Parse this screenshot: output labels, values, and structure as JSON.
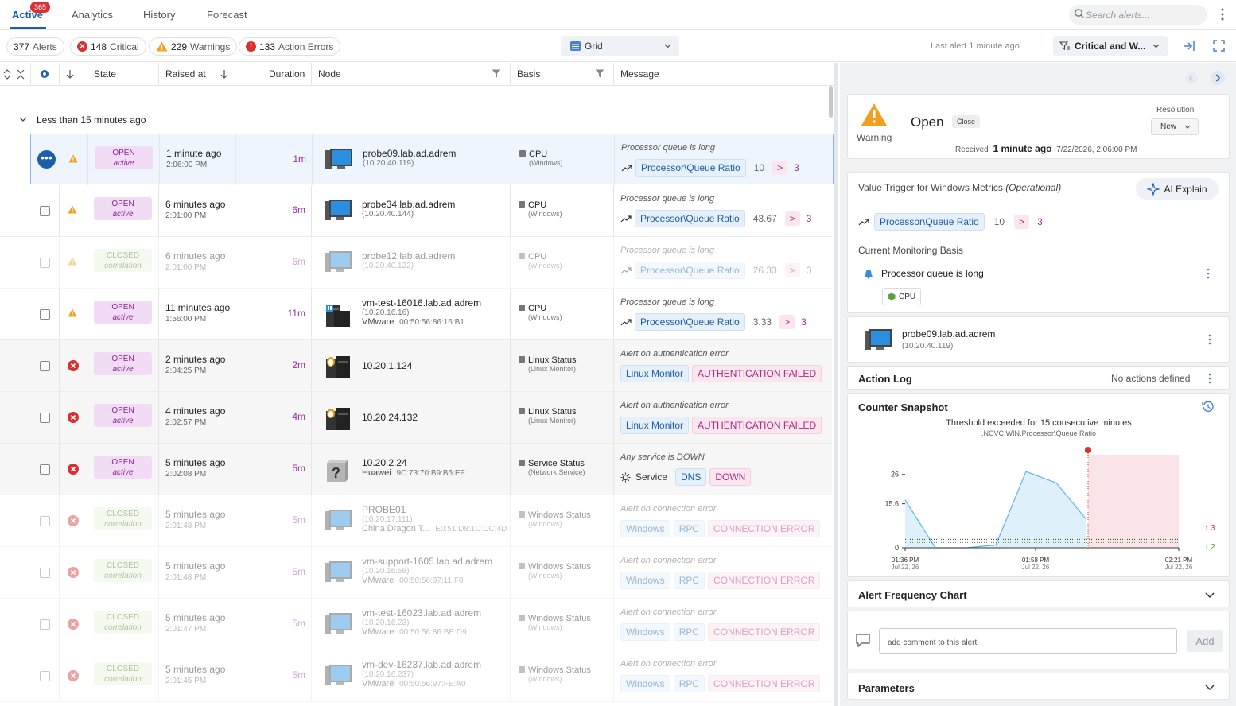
{
  "tabs": [
    {
      "label": "Active",
      "badge": "365"
    },
    {
      "label": "Analytics"
    },
    {
      "label": "History"
    },
    {
      "label": "Forecast"
    }
  ],
  "search": {
    "placeholder": "Search alerts..."
  },
  "summary": {
    "alerts": {
      "count": "377",
      "label": "Alerts"
    },
    "critical": {
      "count": "148",
      "label": "Critical"
    },
    "warnings": {
      "count": "229",
      "label": "Warnings"
    },
    "action_errors": {
      "count": "133",
      "label": "Action Errors"
    },
    "view": "Grid",
    "last_alert": "Last alert 1 minute ago",
    "filter": "Critical and W..."
  },
  "columns": {
    "state": "State",
    "raised": "Raised at",
    "duration": "Duration",
    "node": "Node",
    "basis": "Basis",
    "message": "Message"
  },
  "group_label": "Less than 15 minutes ago",
  "rows": [
    {
      "severity": "warning",
      "state": "OPEN",
      "substate": "active",
      "raised": "1 minute ago",
      "time": "2:06:00 PM",
      "duration": "1m",
      "node": "probe09.lab.ad.adrem",
      "ip": "(10.20.40.119)",
      "extra": "",
      "extra_mac": "",
      "basis": "CPU",
      "basis_sub": "(Windows)",
      "message": "Processor queue is long",
      "chips": [
        "Processor\\Queue Ratio"
      ],
      "value": "10",
      "op": ">",
      "threshold": "3",
      "icon": "windows-server-icon"
    },
    {
      "severity": "warning",
      "state": "OPEN",
      "substate": "active",
      "raised": "6 minutes ago",
      "time": "2:01:00 PM",
      "duration": "6m",
      "node": "probe34.lab.ad.adrem",
      "ip": "(10.20.40.144)",
      "extra": "",
      "extra_mac": "",
      "basis": "CPU",
      "basis_sub": "(Windows)",
      "message": "Processor queue is long",
      "chips": [
        "Processor\\Queue Ratio"
      ],
      "value": "43.67",
      "op": ">",
      "threshold": "3",
      "icon": "windows-server-icon"
    },
    {
      "severity": "warning",
      "state": "CLOSED",
      "substate": "correlation",
      "raised": "6 minutes ago",
      "time": "2:01:00 PM",
      "duration": "6m",
      "node": "probe12.lab.ad.adrem",
      "ip": "(10.20.40.122)",
      "extra": "",
      "extra_mac": "",
      "basis": "CPU",
      "basis_sub": "(Windows)",
      "message": "Processor queue is long",
      "chips": [
        "Processor\\Queue Ratio"
      ],
      "value": "26.33",
      "op": ">",
      "threshold": "3",
      "icon": "windows-server-icon"
    },
    {
      "severity": "warning",
      "state": "OPEN",
      "substate": "active",
      "raised": "11 minutes ago",
      "time": "1:56:00 PM",
      "duration": "11m",
      "node": "vm-test-16016.lab.ad.adrem",
      "ip": "(10.20.16.16)",
      "extra": "VMware",
      "extra_mac": "00:50:56:86:16:B1",
      "basis": "CPU",
      "basis_sub": "(Windows)",
      "message": "Processor queue is long",
      "chips": [
        "Processor\\Queue Ratio"
      ],
      "value": "3.33",
      "op": ">",
      "threshold": "3",
      "icon": "windows-tower-icon"
    },
    {
      "severity": "critical",
      "state": "OPEN",
      "substate": "active",
      "raised": "2 minutes ago",
      "time": "2:04:25 PM",
      "duration": "2m",
      "node": "10.20.1.124",
      "ip": "",
      "extra": "",
      "extra_mac": "",
      "basis": "Linux Status",
      "basis_sub": "(Linux Monitor)",
      "message": "Alert on authentication error",
      "chips": [
        "Linux Monitor"
      ],
      "value": "",
      "op": "",
      "threshold": "",
      "error_chip": "AUTHENTICATION FAILED",
      "icon": "linux-tower-icon"
    },
    {
      "severity": "critical",
      "state": "OPEN",
      "substate": "active",
      "raised": "4 minutes ago",
      "time": "2:02:57 PM",
      "duration": "4m",
      "node": "10.20.24.132",
      "ip": "",
      "extra": "",
      "extra_mac": "",
      "basis": "Linux Status",
      "basis_sub": "(Linux Monitor)",
      "message": "Alert on authentication error",
      "chips": [
        "Linux Monitor"
      ],
      "value": "",
      "op": "",
      "threshold": "",
      "error_chip": "AUTHENTICATION FAILED",
      "icon": "linux-tower-icon"
    },
    {
      "severity": "critical",
      "state": "OPEN",
      "substate": "active",
      "raised": "5 minutes ago",
      "time": "2:02:08 PM",
      "duration": "5m",
      "node": "10.20.2.24",
      "ip": "",
      "extra": "Huawei",
      "extra_mac": "9C:73:70:B9:B5:EF",
      "basis": "Service Status",
      "basis_sub": "(Network Service)",
      "message": "Any service is DOWN",
      "service_label": "Service",
      "chips": [
        "DNS"
      ],
      "value": "",
      "op": "",
      "threshold": "",
      "error_chip": "DOWN",
      "icon": "unknown-device-icon"
    },
    {
      "severity": "critical",
      "state": "CLOSED",
      "substate": "correlation",
      "raised": "5 minutes ago",
      "time": "2:01:48 PM",
      "duration": "5m",
      "node": "PROBE01",
      "ip": "(10.20.17.111)",
      "extra": "China Dragon T...",
      "extra_mac": "E0:51:D8:1C:CC:4D",
      "basis": "Windows Status",
      "basis_sub": "(Windows)",
      "message": "Alert on connection error",
      "chips": [
        "Windows",
        "RPC"
      ],
      "value": "",
      "op": "",
      "threshold": "",
      "error_chip": "CONNECTION ERROR",
      "icon": "windows-server-icon"
    },
    {
      "severity": "critical",
      "state": "CLOSED",
      "substate": "correlation",
      "raised": "5 minutes ago",
      "time": "2:01:48 PM",
      "duration": "5m",
      "node": "vm-support-1605.lab.ad.adrem",
      "ip": "(10.20.16.58)",
      "extra": "VMware",
      "extra_mac": "00:50:56:97:11:F0",
      "basis": "Windows Status",
      "basis_sub": "(Windows)",
      "message": "Alert on connection error",
      "chips": [
        "Windows",
        "RPC"
      ],
      "value": "",
      "op": "",
      "threshold": "",
      "error_chip": "CONNECTION ERROR",
      "icon": "windows-server-icon"
    },
    {
      "severity": "critical",
      "state": "CLOSED",
      "substate": "correlation",
      "raised": "5 minutes ago",
      "time": "2:01:47 PM",
      "duration": "5m",
      "node": "vm-test-16023.lab.ad.adrem",
      "ip": "(10.20.16.23)",
      "extra": "VMware",
      "extra_mac": "00:50:56:86:BE:D9",
      "basis": "Windows Status",
      "basis_sub": "(Windows)",
      "message": "Alert on connection error",
      "chips": [
        "Windows",
        "RPC"
      ],
      "value": "",
      "op": "",
      "threshold": "",
      "error_chip": "CONNECTION ERROR",
      "icon": "windows-server-icon"
    },
    {
      "severity": "critical",
      "state": "CLOSED",
      "substate": "correlation",
      "raised": "5 minutes ago",
      "time": "2:01:45 PM",
      "duration": "5m",
      "node": "vm-dev-16237.lab.ad.adrem",
      "ip": "(10.20.16.237)",
      "extra": "VMware",
      "extra_mac": "00:50:56:97:FE:A0",
      "basis": "Windows Status",
      "basis_sub": "(Windows)",
      "message": "Alert on connection error",
      "chips": [
        "Windows",
        "RPC"
      ],
      "value": "",
      "op": "",
      "threshold": "",
      "error_chip": "CONNECTION ERROR",
      "icon": "windows-server-icon"
    }
  ],
  "detail": {
    "severity_label": "Warning",
    "state": "Open",
    "close_label": "Close",
    "resolution_label": "Resolution",
    "resolution_value": "New",
    "received_label": "Received",
    "received_rel": "1 minute ago",
    "received_abs": "7/22/2026, 2:06:00 PM",
    "trigger_title": "Value Trigger for Windows Metrics",
    "trigger_sub": "(Operational)",
    "ai_label": "AI Explain",
    "trigger_chip": "Processor\\Queue Ratio",
    "trigger_value": "10",
    "trigger_op": ">",
    "trigger_threshold": "3",
    "basis_title": "Current Monitoring Basis",
    "basis_alert": "Processor queue is long",
    "basis_chip": "CPU",
    "node_name": "probe09.lab.ad.adrem",
    "node_ip": "(10.20.40.119)",
    "action_log": "Action Log",
    "no_actions": "No actions defined",
    "snapshot_title": "Counter Snapshot",
    "alert_freq": "Alert Frequency Chart",
    "comment_placeholder": "add comment to this alert",
    "add_label": "Add",
    "parameters": "Parameters",
    "colors": {
      "accent": "#1a5fa8",
      "critical": "#d93030",
      "warning": "#f0a020",
      "threshold_zone": "#fbe4e8",
      "series": "#5bb8e8"
    }
  },
  "chart_data": {
    "type": "area",
    "title": "Threshold exceeded for 15 consecutive minutes",
    "subtitle": ".NCVC.WIN.Processor\\Queue Ratio",
    "x": [
      "1:36 PM",
      "1:40 PM",
      "1:45 PM",
      "1:50 PM",
      "1:54 PM",
      "1:58 PM",
      "2:02 PM",
      "2:06 PM"
    ],
    "y_ticks": [
      "26",
      "15.6",
      "0"
    ],
    "x_ticks": [
      {
        "time": "01:36 PM",
        "date": "Jul 22, 26"
      },
      {
        "time": "01:58 PM",
        "date": "Jul 22, 26"
      },
      {
        "time": "02:21 PM",
        "date": "Jul 22, 26"
      }
    ],
    "values": [
      17,
      0,
      0,
      1,
      27,
      23,
      10,
      null
    ],
    "threshold": 3,
    "ylim": [
      0,
      31
    ],
    "markers": {
      "up": "3",
      "down": "2"
    },
    "grid": false
  }
}
